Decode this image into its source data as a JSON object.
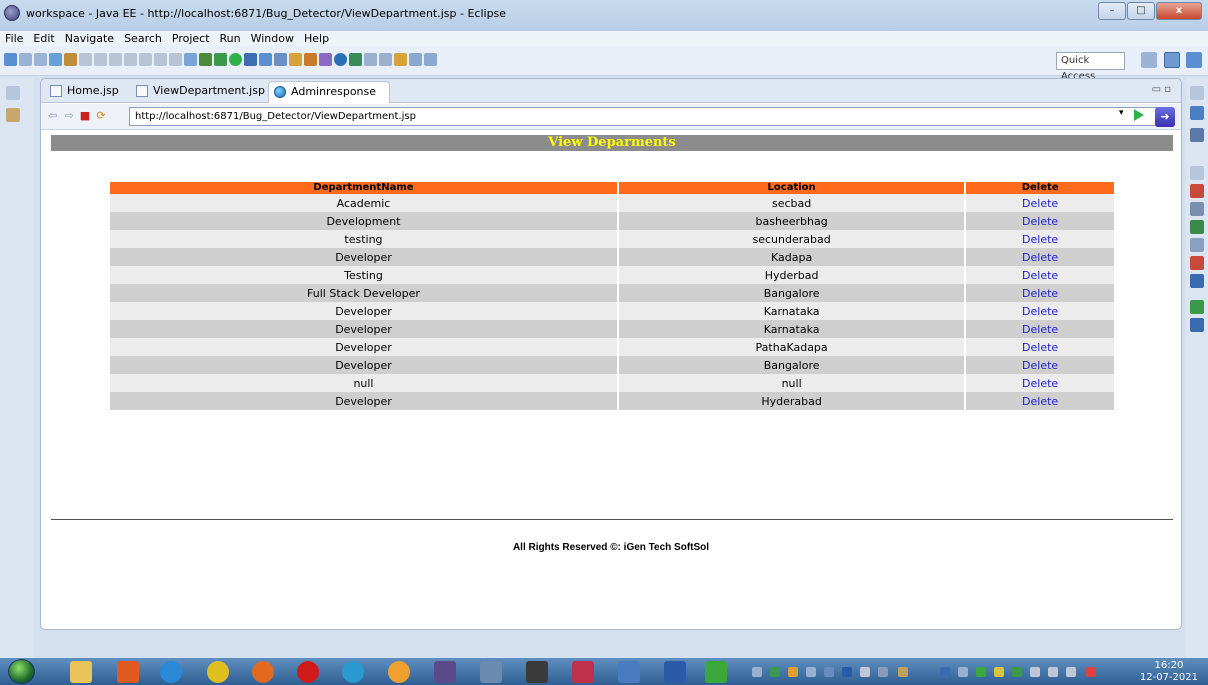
{
  "window": {
    "title": "workspace - Java EE - http://localhost:6871/Bug_Detector/ViewDepartment.jsp - Eclipse",
    "minimize": "–",
    "maximize": "□",
    "close": "x"
  },
  "menu": [
    "File",
    "Edit",
    "Navigate",
    "Search",
    "Project",
    "Run",
    "Window",
    "Help"
  ],
  "toolbar": {
    "quick_access": "Quick Access"
  },
  "editor_tabs": [
    {
      "label": "Home.jsp",
      "icon": "jsp-file-icon"
    },
    {
      "label": "ViewDepartment.jsp",
      "icon": "jsp-file-icon"
    },
    {
      "label": "Adminresponse",
      "icon": "globe-icon",
      "close": "☒"
    }
  ],
  "browser": {
    "url": "http://localhost:6871/Bug_Detector/ViewDepartment.jsp",
    "back": "⇦",
    "forward": "⇨",
    "stop": "■",
    "dropdown": "▾"
  },
  "page": {
    "heading": "View Deparments",
    "columns": [
      "DepartmentName",
      "Location",
      "Delete"
    ],
    "rows": [
      [
        "Academic",
        "secbad",
        "Delete"
      ],
      [
        "Development",
        "basheerbhag",
        "Delete"
      ],
      [
        "testing",
        "secunderabad",
        "Delete"
      ],
      [
        "Developer",
        "Kadapa",
        "Delete"
      ],
      [
        "Testing",
        "Hyderbad",
        "Delete"
      ],
      [
        "Full Stack Developer",
        "Bangalore",
        "Delete"
      ],
      [
        "Developer",
        "Karnataka",
        "Delete"
      ],
      [
        "Developer",
        "Karnataka",
        "Delete"
      ],
      [
        "Developer",
        "PathaKadapa",
        "Delete"
      ],
      [
        "Developer",
        "Bangalore",
        "Delete"
      ],
      [
        "null",
        "null",
        "Delete"
      ],
      [
        "Developer",
        "Hyderabad",
        "Delete"
      ]
    ],
    "footer": "All Rights Reserved ©: iGen Tech SoftSol"
  },
  "taskbar": {
    "time": "16:20",
    "date": "12-07-2021"
  },
  "colors": {
    "heading_bg": "#8c8c8c",
    "heading_text": "#ffff00",
    "header_bg": "#ff6a1d",
    "link": "#2222cc"
  }
}
